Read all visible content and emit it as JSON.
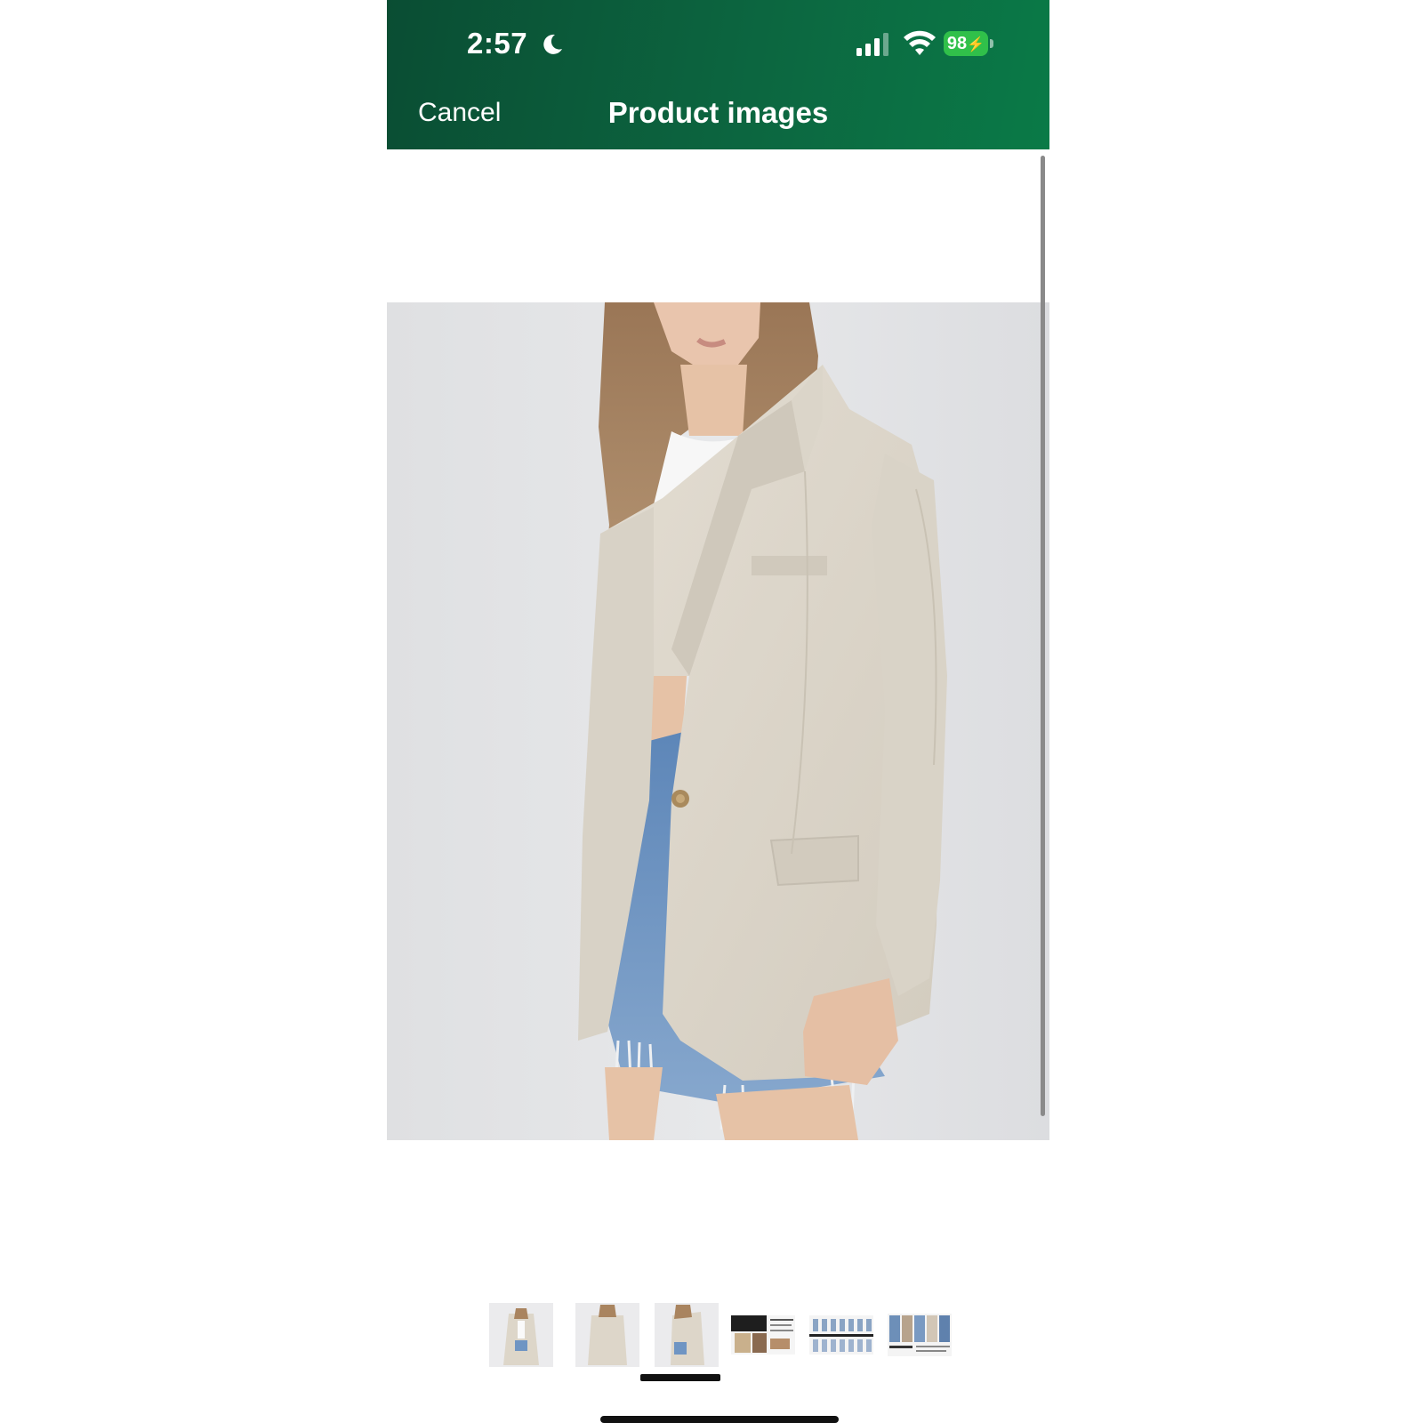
{
  "status_bar": {
    "time": "2:57",
    "battery_percent": "98",
    "icons": [
      "moon-icon",
      "cellular-signal-icon",
      "wifi-icon",
      "battery-charging-icon"
    ]
  },
  "header": {
    "cancel_label": "Cancel",
    "title": "Product images"
  },
  "colors": {
    "header_green": "#0c6640",
    "battery_green": "#30c04a",
    "photo_background": "#e4e5e7"
  },
  "thumbnails": {
    "count": 6,
    "selected_index": 2
  }
}
